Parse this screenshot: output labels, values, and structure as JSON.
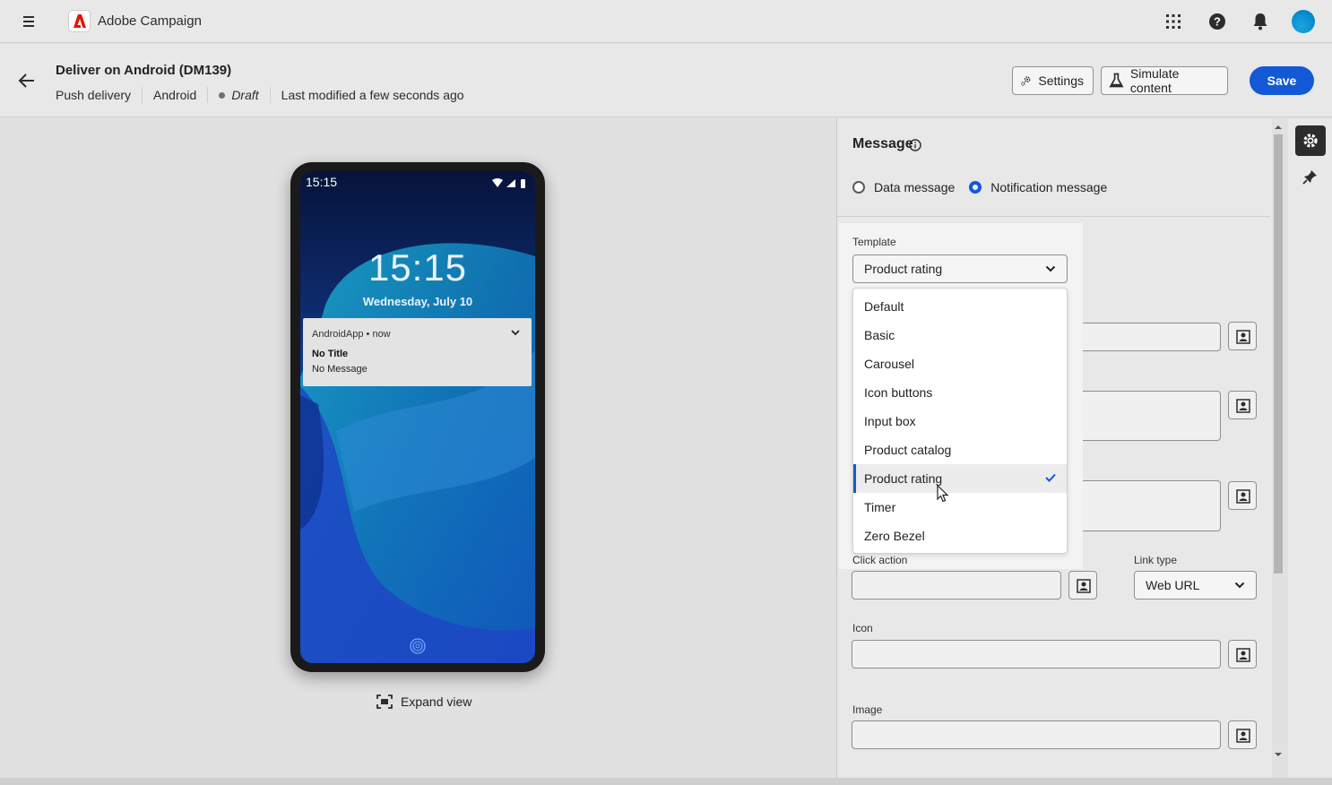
{
  "app": {
    "title": "Adobe Campaign"
  },
  "icons": {
    "menu": "hamburger-icon",
    "apps": "grid-icon",
    "help": "help-icon",
    "notifications": "bell-icon"
  },
  "header": {
    "title": "Deliver on Android (DM139)",
    "channel": "Push delivery",
    "platform": "Android",
    "status": "Draft",
    "last_modified": "Last modified a few seconds ago",
    "settings_label": "Settings",
    "simulate_label": "Simulate content",
    "save_label": "Save"
  },
  "phone": {
    "status_time": "15:15",
    "lock_time": "15:15",
    "lock_date": "Wednesday, July 10",
    "notification": {
      "app": "AndroidApp • now",
      "title": "No Title",
      "message": "No Message"
    }
  },
  "preview": {
    "expand_label": "Expand view"
  },
  "message": {
    "title": "Message",
    "radio": [
      {
        "label": "Data message",
        "selected": false
      },
      {
        "label": "Notification message",
        "selected": true
      }
    ],
    "template_label": "Template",
    "template_value": "Product rating",
    "template_options": [
      "Default",
      "Basic",
      "Carousel",
      "Icon buttons",
      "Input box",
      "Product catalog",
      "Product rating",
      "Timer",
      "Zero Bezel"
    ],
    "selected_option": "Product rating",
    "click_action_label": "Click action",
    "link_type_label": "Link type",
    "link_type_value": "Web URL",
    "icon_label": "Icon",
    "image_label": "Image"
  },
  "colors": {
    "accent": "#1359d6",
    "brand": "#eb1000"
  }
}
